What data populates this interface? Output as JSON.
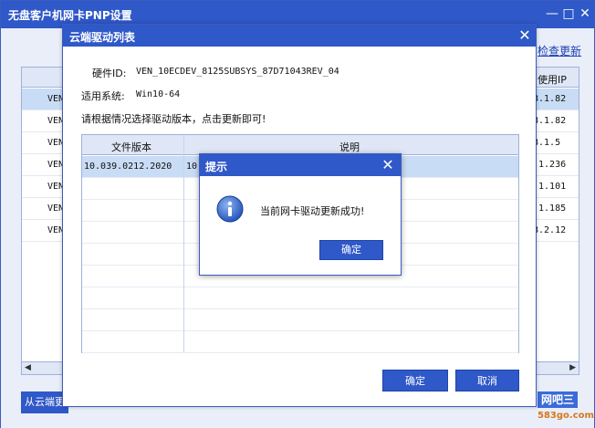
{
  "outer": {
    "title": "无盘客户机网卡PNP设置",
    "check_update": "检查更新",
    "ip_header": "使用IP",
    "rows": [
      {
        "ven": "VEN",
        "ip": "8.1.82",
        "selected": true
      },
      {
        "ven": "VEN",
        "ip": "8.1.82",
        "selected": false
      },
      {
        "ven": "VEN",
        "ip": "8.1.5",
        "selected": false
      },
      {
        "ven": "VEN",
        "ip": ".1.236",
        "selected": false
      },
      {
        "ven": "VEN",
        "ip": ".1.101",
        "selected": false
      },
      {
        "ven": "VEN",
        "ip": ".1.185",
        "selected": false
      },
      {
        "ven": "VEN",
        "ip": "8.2.12",
        "selected": false
      }
    ],
    "bottom_button": "从云端更",
    "watermark": "网吧三",
    "watermark_url": "583go.com"
  },
  "cloud": {
    "title": "云端驱动列表",
    "hardware_id_label": "硬件ID:",
    "hardware_id_value": "VEN_10ECDEV_8125SUBSYS_87D71043REV_04",
    "os_label": "适用系统:",
    "os_value": "Win10-64",
    "instruction": "请根据情况选择驱动版本，点击更新即可!",
    "columns": [
      "文件版本",
      "说明"
    ],
    "rows": [
      {
        "version": "10.039.0212.2020",
        "desc": "10."
      }
    ],
    "ok_label": "确定",
    "cancel_label": "取消"
  },
  "prompt": {
    "title": "提示",
    "message": "当前网卡驱动更新成功!",
    "ok_label": "确定"
  },
  "colors": {
    "title_bar": "#2f58c8",
    "selection": "#c9dcf5",
    "link": "#1a3fb5"
  }
}
